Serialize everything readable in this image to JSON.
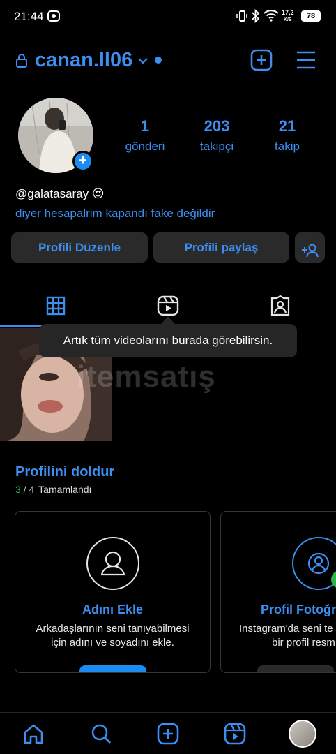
{
  "status_bar": {
    "time": "21:44",
    "network_speed_value": "17,2",
    "network_speed_unit": "K/S",
    "battery": "78"
  },
  "header": {
    "username": "canan.ll06"
  },
  "profile": {
    "stats": [
      {
        "value": "1",
        "label": "gönderi"
      },
      {
        "value": "203",
        "label": "takipçi"
      },
      {
        "value": "21",
        "label": "takip"
      }
    ],
    "bio_handle": "@galatasaray 😍",
    "bio_text": "diyer hesapalrim kapandı fake değildir"
  },
  "actions": {
    "edit_label": "Profili Düzenle",
    "share_label": "Profili paylaş"
  },
  "tooltip": "Artık tüm videolarını burada görebilirsin.",
  "watermark": "itemsatış",
  "complete_profile": {
    "title": "Profilini doldur",
    "progress_done": "3",
    "progress_total": "/ 4",
    "progress_label": "Tamamlandı",
    "cards": [
      {
        "title": "Adını Ekle",
        "desc_line1": "Arkadaşlarının seni tanıyabilmesi",
        "desc_line2": "için adını ve soyadını ekle."
      },
      {
        "title": "Profil Fotoğra",
        "desc_line1": "Instagram'da seni te",
        "desc_line2": "bir profil resm"
      }
    ]
  },
  "colors": {
    "accent": "#3d8ef0",
    "background": "#000000",
    "button_bg": "#2a2a2a",
    "complete_green": "#2fb24c"
  }
}
